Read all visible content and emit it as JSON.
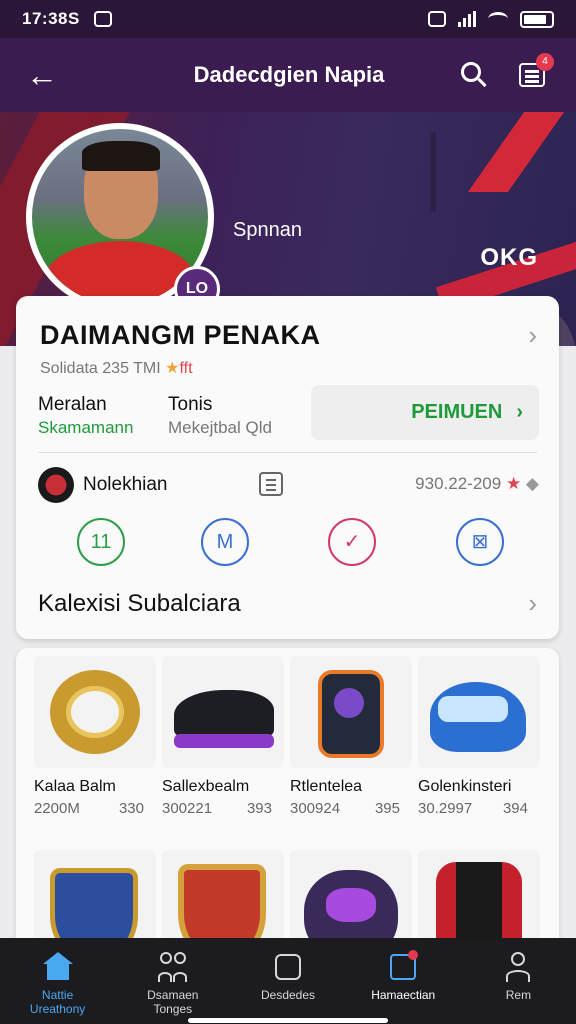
{
  "status_bar": {
    "time": "17:38S"
  },
  "app_bar": {
    "back_glyph": "←",
    "title": "Dadecdgien Napia",
    "notification_count": "4"
  },
  "hero": {
    "name": "Spnnan",
    "logo_text": "OKG",
    "avatar_badge": "LO"
  },
  "profile": {
    "name": "DAIMANGM PENAKA",
    "subtitle": "Solidata 235 TMI",
    "subtitle_star": "★",
    "subtitle_suffix": "fft",
    "col1_heading": "Meralan",
    "col1_value": "Skamamann",
    "col2_heading": "Tonis",
    "col2_value": "Mekejtbal Qld",
    "primary_button": "PEIMUEN",
    "primary_button_chevron": "›",
    "club_name": "Nolekhian",
    "stat_value": "930.22-209",
    "stat_star": "★",
    "stat_extra": "◆",
    "chevron": "›",
    "action_circles": [
      {
        "label": "11",
        "color": "#2e9d4a"
      },
      {
        "label": "M",
        "color": "#3a6fd1"
      },
      {
        "label": "✓",
        "color": "#d23a6a"
      },
      {
        "label": "⊠",
        "color": "#3a6fd1"
      }
    ],
    "collection_title": "Kalexisi Subalciara"
  },
  "items": [
    {
      "name": "Kalaa Balm",
      "price": "2200M",
      "qty": "330",
      "icon": "ring-icon"
    },
    {
      "name": "Sallexbealm",
      "price": "300221",
      "qty": "393",
      "icon": "shoe-icon"
    },
    {
      "name": "Rtlentelea",
      "price": "300924",
      "qty": "395",
      "icon": "backpack-icon"
    },
    {
      "name": "Golenkinsteri",
      "price": "30.2997",
      "qty": "394",
      "icon": "helmet-icon"
    },
    {
      "name": "",
      "price": "",
      "qty": "",
      "icon": "shield-icon"
    },
    {
      "name": "",
      "price": "",
      "qty": "",
      "icon": "crest-icon"
    },
    {
      "name": "",
      "price": "",
      "qty": "",
      "icon": "robot-icon"
    },
    {
      "name": "",
      "price": "",
      "qty": "",
      "icon": "jacket-icon"
    }
  ],
  "bottom_nav": [
    {
      "label": "Nattie Ureathony",
      "icon": "home-icon",
      "active": true
    },
    {
      "label": "Dsamaen Tonges",
      "icon": "people-icon",
      "active": false
    },
    {
      "label": "Desdedes",
      "icon": "square-icon",
      "active": false
    },
    {
      "label": "Hamaectian",
      "icon": "edit-icon",
      "active": true
    },
    {
      "label": "Rem",
      "icon": "user-icon",
      "active": false
    }
  ],
  "colors": {
    "accent_green": "#1e9a3a",
    "brand_purple": "#3b1c50",
    "nav_active": "#4aa8f0"
  }
}
